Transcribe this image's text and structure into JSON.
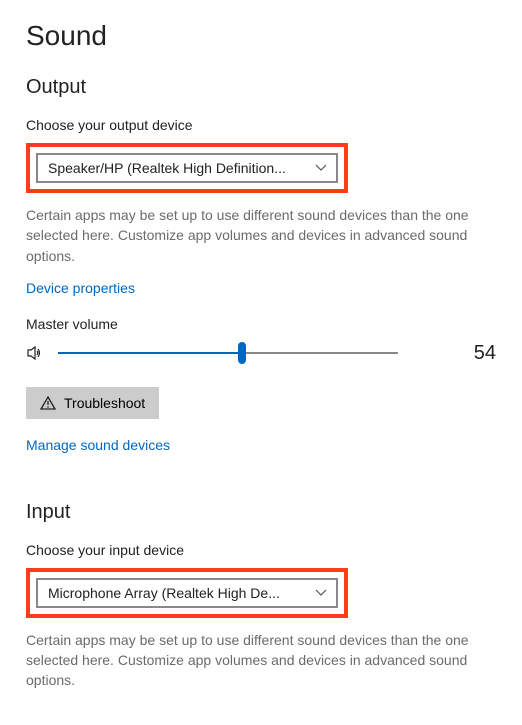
{
  "page": {
    "title": "Sound"
  },
  "output": {
    "heading": "Output",
    "device_label": "Choose your output device",
    "device_selected": "Speaker/HP (Realtek High Definition...",
    "help_text": "Certain apps may be set up to use different sound devices than the one selected here. Customize app volumes and devices in advanced sound options.",
    "device_properties_link": "Device properties",
    "master_volume_label": "Master volume",
    "master_volume_value": "54",
    "master_volume_percent": 54,
    "troubleshoot_label": "Troubleshoot",
    "manage_devices_link": "Manage sound devices"
  },
  "input": {
    "heading": "Input",
    "device_label": "Choose your input device",
    "device_selected": "Microphone Array (Realtek High De...",
    "help_text": "Certain apps may be set up to use different sound devices than the one selected here. Customize app volumes and devices in advanced sound options."
  }
}
